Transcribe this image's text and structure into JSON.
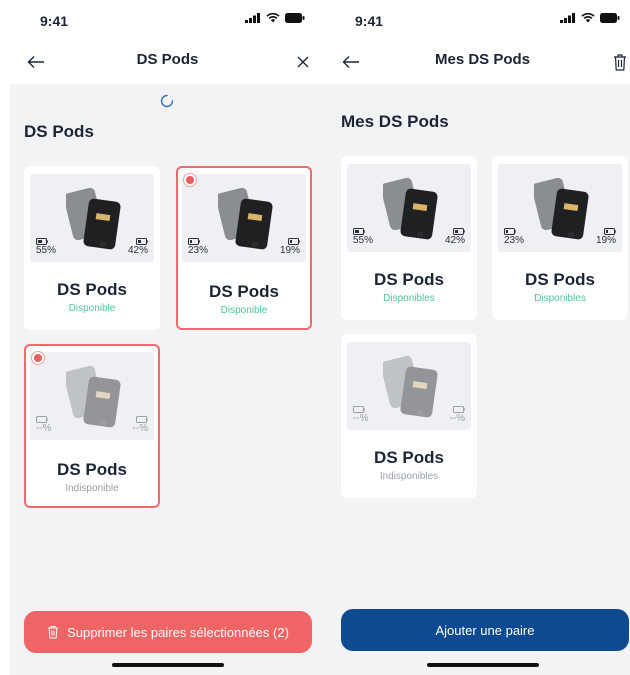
{
  "status_bar": {
    "time": "9:41"
  },
  "left_screen": {
    "nav_title": "DS Pods",
    "section_title": "DS Pods",
    "cards": [
      {
        "name": "DS Pods",
        "status": "Disponible",
        "battery_left": "55%",
        "battery_right": "42%",
        "selected": false
      },
      {
        "name": "DS Pods",
        "status": "Disponible",
        "battery_left": "23%",
        "battery_right": "19%",
        "selected": true
      },
      {
        "name": "DS Pods",
        "status": "Indisponible",
        "battery_left": "--%",
        "battery_right": "--%",
        "selected": true
      }
    ],
    "delete_button_label": "Supprimer les paires sélectionnées (2)"
  },
  "right_screen": {
    "nav_title": "Mes DS Pods",
    "section_title": "Mes DS Pods",
    "cards": [
      {
        "name": "DS Pods",
        "status": "Disponibles",
        "battery_left": "55%",
        "battery_right": "42%"
      },
      {
        "name": "DS Pods",
        "status": "Disponibles",
        "battery_left": "23%",
        "battery_right": "19%"
      },
      {
        "name": "DS Pods",
        "status": "Indisponibles",
        "battery_left": "--%",
        "battery_right": "--%"
      }
    ],
    "add_button_label": "Ajouter une paire"
  },
  "colors": {
    "selection_red": "#ee6b6b",
    "available_green": "#4fc79a",
    "primary_blue": "#0d4a91",
    "danger_red": "#ef6464"
  }
}
